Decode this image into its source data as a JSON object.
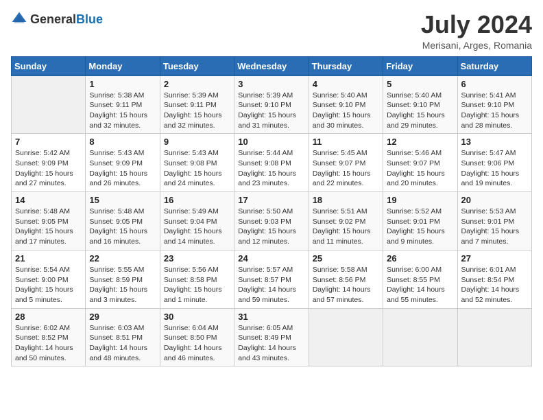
{
  "header": {
    "logo": {
      "general": "General",
      "blue": "Blue"
    },
    "title": "July 2024",
    "location": "Merisani, Arges, Romania"
  },
  "days_of_week": [
    "Sunday",
    "Monday",
    "Tuesday",
    "Wednesday",
    "Thursday",
    "Friday",
    "Saturday"
  ],
  "weeks": [
    [
      {
        "day": "",
        "info": ""
      },
      {
        "day": "1",
        "info": "Sunrise: 5:38 AM\nSunset: 9:11 PM\nDaylight: 15 hours\nand 32 minutes."
      },
      {
        "day": "2",
        "info": "Sunrise: 5:39 AM\nSunset: 9:11 PM\nDaylight: 15 hours\nand 32 minutes."
      },
      {
        "day": "3",
        "info": "Sunrise: 5:39 AM\nSunset: 9:10 PM\nDaylight: 15 hours\nand 31 minutes."
      },
      {
        "day": "4",
        "info": "Sunrise: 5:40 AM\nSunset: 9:10 PM\nDaylight: 15 hours\nand 30 minutes."
      },
      {
        "day": "5",
        "info": "Sunrise: 5:40 AM\nSunset: 9:10 PM\nDaylight: 15 hours\nand 29 minutes."
      },
      {
        "day": "6",
        "info": "Sunrise: 5:41 AM\nSunset: 9:10 PM\nDaylight: 15 hours\nand 28 minutes."
      }
    ],
    [
      {
        "day": "7",
        "info": "Sunrise: 5:42 AM\nSunset: 9:09 PM\nDaylight: 15 hours\nand 27 minutes."
      },
      {
        "day": "8",
        "info": "Sunrise: 5:43 AM\nSunset: 9:09 PM\nDaylight: 15 hours\nand 26 minutes."
      },
      {
        "day": "9",
        "info": "Sunrise: 5:43 AM\nSunset: 9:08 PM\nDaylight: 15 hours\nand 24 minutes."
      },
      {
        "day": "10",
        "info": "Sunrise: 5:44 AM\nSunset: 9:08 PM\nDaylight: 15 hours\nand 23 minutes."
      },
      {
        "day": "11",
        "info": "Sunrise: 5:45 AM\nSunset: 9:07 PM\nDaylight: 15 hours\nand 22 minutes."
      },
      {
        "day": "12",
        "info": "Sunrise: 5:46 AM\nSunset: 9:07 PM\nDaylight: 15 hours\nand 20 minutes."
      },
      {
        "day": "13",
        "info": "Sunrise: 5:47 AM\nSunset: 9:06 PM\nDaylight: 15 hours\nand 19 minutes."
      }
    ],
    [
      {
        "day": "14",
        "info": "Sunrise: 5:48 AM\nSunset: 9:05 PM\nDaylight: 15 hours\nand 17 minutes."
      },
      {
        "day": "15",
        "info": "Sunrise: 5:48 AM\nSunset: 9:05 PM\nDaylight: 15 hours\nand 16 minutes."
      },
      {
        "day": "16",
        "info": "Sunrise: 5:49 AM\nSunset: 9:04 PM\nDaylight: 15 hours\nand 14 minutes."
      },
      {
        "day": "17",
        "info": "Sunrise: 5:50 AM\nSunset: 9:03 PM\nDaylight: 15 hours\nand 12 minutes."
      },
      {
        "day": "18",
        "info": "Sunrise: 5:51 AM\nSunset: 9:02 PM\nDaylight: 15 hours\nand 11 minutes."
      },
      {
        "day": "19",
        "info": "Sunrise: 5:52 AM\nSunset: 9:01 PM\nDaylight: 15 hours\nand 9 minutes."
      },
      {
        "day": "20",
        "info": "Sunrise: 5:53 AM\nSunset: 9:01 PM\nDaylight: 15 hours\nand 7 minutes."
      }
    ],
    [
      {
        "day": "21",
        "info": "Sunrise: 5:54 AM\nSunset: 9:00 PM\nDaylight: 15 hours\nand 5 minutes."
      },
      {
        "day": "22",
        "info": "Sunrise: 5:55 AM\nSunset: 8:59 PM\nDaylight: 15 hours\nand 3 minutes."
      },
      {
        "day": "23",
        "info": "Sunrise: 5:56 AM\nSunset: 8:58 PM\nDaylight: 15 hours\nand 1 minute."
      },
      {
        "day": "24",
        "info": "Sunrise: 5:57 AM\nSunset: 8:57 PM\nDaylight: 14 hours\nand 59 minutes."
      },
      {
        "day": "25",
        "info": "Sunrise: 5:58 AM\nSunset: 8:56 PM\nDaylight: 14 hours\nand 57 minutes."
      },
      {
        "day": "26",
        "info": "Sunrise: 6:00 AM\nSunset: 8:55 PM\nDaylight: 14 hours\nand 55 minutes."
      },
      {
        "day": "27",
        "info": "Sunrise: 6:01 AM\nSunset: 8:54 PM\nDaylight: 14 hours\nand 52 minutes."
      }
    ],
    [
      {
        "day": "28",
        "info": "Sunrise: 6:02 AM\nSunset: 8:52 PM\nDaylight: 14 hours\nand 50 minutes."
      },
      {
        "day": "29",
        "info": "Sunrise: 6:03 AM\nSunset: 8:51 PM\nDaylight: 14 hours\nand 48 minutes."
      },
      {
        "day": "30",
        "info": "Sunrise: 6:04 AM\nSunset: 8:50 PM\nDaylight: 14 hours\nand 46 minutes."
      },
      {
        "day": "31",
        "info": "Sunrise: 6:05 AM\nSunset: 8:49 PM\nDaylight: 14 hours\nand 43 minutes."
      },
      {
        "day": "",
        "info": ""
      },
      {
        "day": "",
        "info": ""
      },
      {
        "day": "",
        "info": ""
      }
    ]
  ]
}
